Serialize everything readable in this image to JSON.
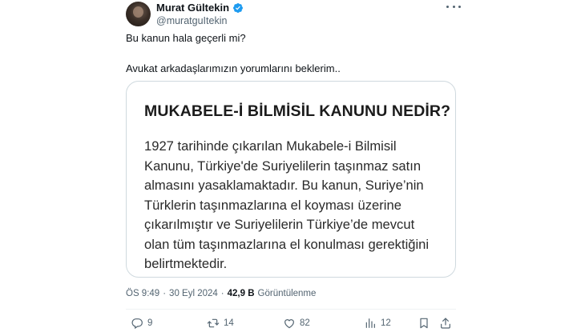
{
  "author": {
    "display_name": "Murat Gültekin",
    "handle": "@muratguItekin",
    "verified": true
  },
  "tweet": {
    "lines": [
      "Bu kanun hala geçerli mi?",
      "Avukat arkadaşlarımızın yorumlarını beklerim.."
    ]
  },
  "media_card": {
    "title": "MUKABELE-İ BİLMİSİL KANUNU NEDİR?",
    "body_lines": [
      "1927 tarihinde çıkarılan Mukabele-i Bilmisil",
      "Kanunu, Türkiye'de Suriyelilerin taşınmaz satın",
      "almasını yasaklamaktadır. Bu kanun, Suriye’nin",
      "Türklerin taşınmazlarına el koyması üzerine",
      "çıkarılmıştır ve Suriyelilerin Türkiye’de mevcut",
      "olan tüm taşınmazlarına el konulması gerektiğini",
      "belirtmektedir."
    ]
  },
  "meta": {
    "time": "ÖS 9:49",
    "separator": "·",
    "date": "30 Eyl 2024",
    "views_count": "42,9 B",
    "views_label": "Görüntülenme"
  },
  "actions": {
    "reply_count": "9",
    "retweet_count": "14",
    "like_count": "82",
    "views_count": "12"
  },
  "icons": {
    "verified": "verified-badge-icon",
    "more": "more-options-icon",
    "reply": "reply-icon",
    "retweet": "retweet-icon",
    "like": "heart-icon",
    "views": "views-chart-icon",
    "bookmark": "bookmark-icon",
    "share": "share-icon"
  },
  "colors": {
    "accent": "#1d9bf0",
    "secondary_text": "#536471",
    "primary_text": "#0f1419",
    "border": "#cfd9de"
  }
}
